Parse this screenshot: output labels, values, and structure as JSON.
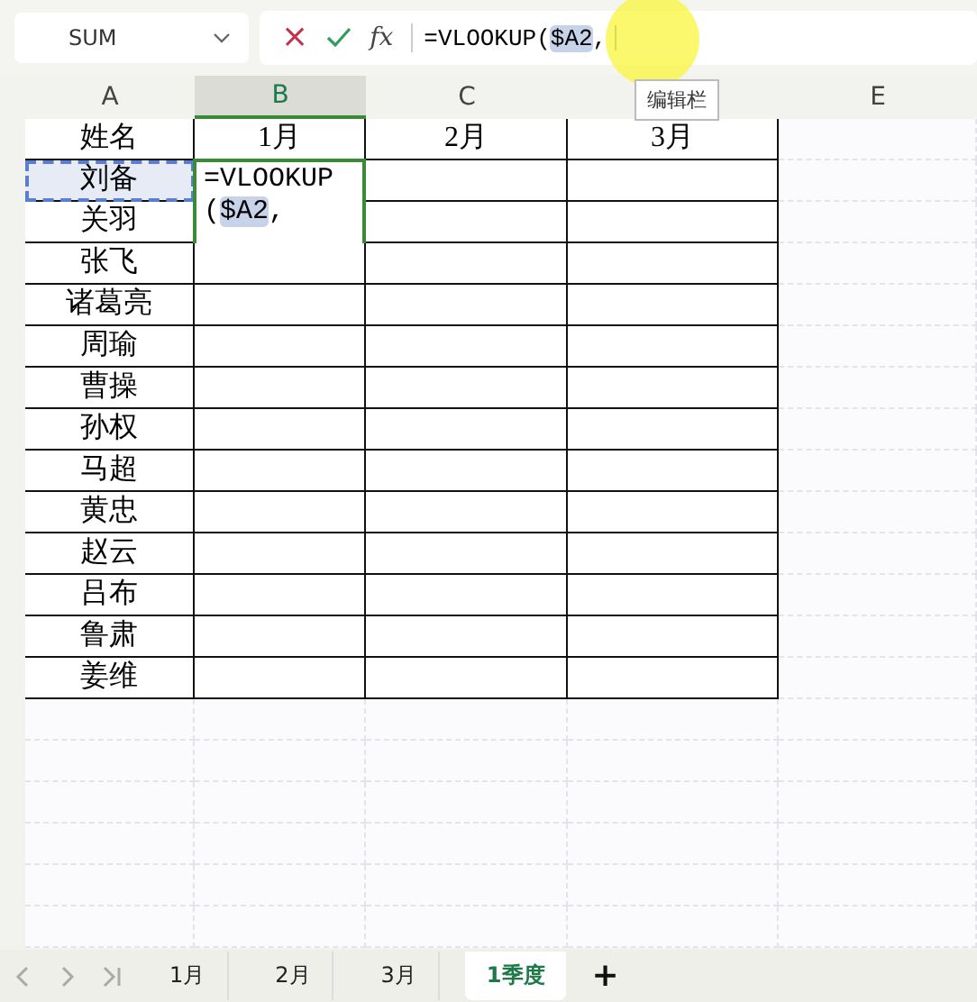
{
  "name_box": {
    "value": "SUM"
  },
  "formula_bar": {
    "cancel": "×",
    "fx": "fx",
    "parts": [
      {
        "text": "=VLOOKUP(",
        "kind": "plain"
      },
      {
        "text": "$A2",
        "kind": "ref"
      },
      {
        "text": ",",
        "kind": "plain"
      }
    ]
  },
  "tooltip": "编辑栏",
  "columns": [
    {
      "label": "A",
      "selected": false
    },
    {
      "label": "B",
      "selected": true
    },
    {
      "label": "C",
      "selected": false
    },
    {
      "covered": true,
      "selected": false
    },
    {
      "label": "E",
      "selected": false
    }
  ],
  "table": {
    "header": [
      "姓名",
      "1月",
      "2月",
      "3月"
    ],
    "rows": [
      {
        "name": "刘备",
        "referenced": true
      },
      {
        "name": "关羽",
        "referenced": false
      },
      {
        "name": "张飞",
        "referenced": false
      },
      {
        "name": "诸葛亮",
        "referenced": false
      },
      {
        "name": "周瑜",
        "referenced": false
      },
      {
        "name": "曹操",
        "referenced": false
      },
      {
        "name": "孙权",
        "referenced": false
      },
      {
        "name": "马超",
        "referenced": false
      },
      {
        "name": "黄忠",
        "referenced": false
      },
      {
        "name": "赵云",
        "referenced": false
      },
      {
        "name": "吕布",
        "referenced": false
      },
      {
        "name": "鲁肃",
        "referenced": false
      },
      {
        "name": "姜维",
        "referenced": false
      }
    ]
  },
  "cell_editor": {
    "lines": [
      [
        {
          "text": "=VLOOKUP",
          "kind": "plain"
        }
      ],
      [
        {
          "text": "(",
          "kind": "plain"
        },
        {
          "text": "$A2",
          "kind": "ref"
        },
        {
          "text": ",",
          "kind": "plain"
        }
      ]
    ]
  },
  "sheet_tabs": [
    {
      "label": "1月",
      "selected": false
    },
    {
      "label": "2月",
      "selected": false
    },
    {
      "label": "3月",
      "selected": false
    },
    {
      "label": "1季度",
      "selected": true
    }
  ],
  "add_sheet": "+"
}
